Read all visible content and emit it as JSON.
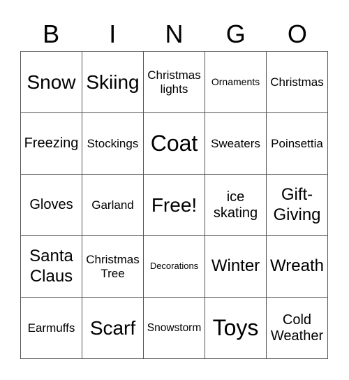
{
  "header": {
    "letters": [
      "B",
      "I",
      "N",
      "G",
      "O"
    ]
  },
  "cells": [
    [
      "Snow",
      "Skiing",
      "Christmas\nlights",
      "Ornaments",
      "Christmas"
    ],
    [
      "Freezing",
      "Stockings",
      "Coat",
      "Sweaters",
      "Poinsettia"
    ],
    [
      "Gloves",
      "Garland",
      "Free!",
      "ice\nskating",
      "Gift-\nGiving"
    ],
    [
      "Santa\nClaus",
      "Christmas\nTree",
      "Decorations",
      "Winter",
      "Wreath"
    ],
    [
      "Earmuffs",
      "Scarf",
      "Snowstorm",
      "Toys",
      "Cold\nWeather"
    ]
  ]
}
